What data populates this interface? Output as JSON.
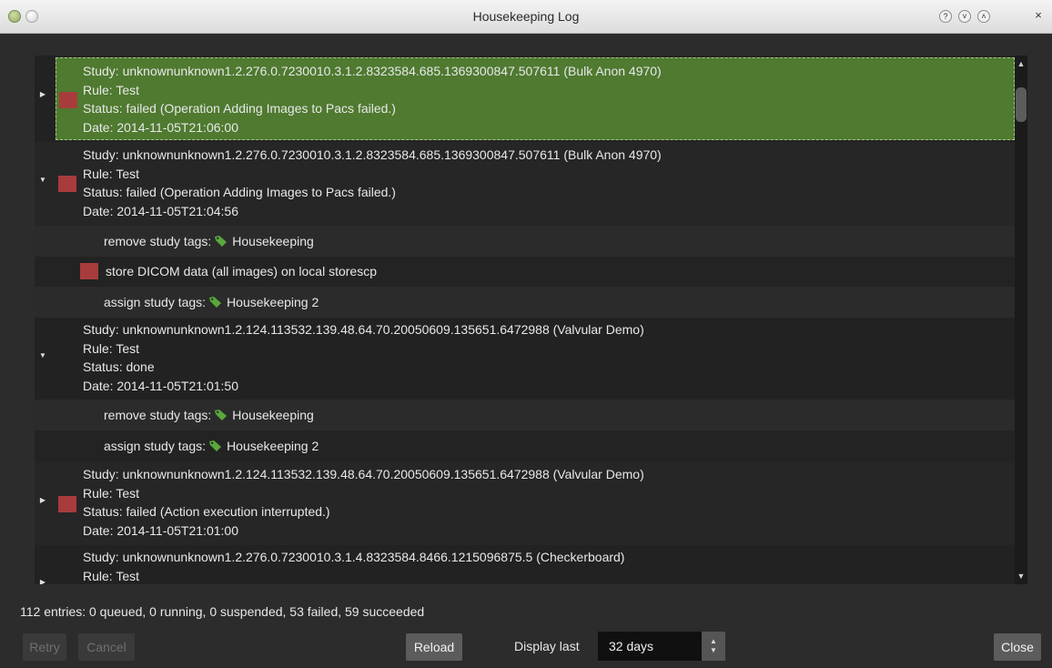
{
  "window": {
    "title": "Housekeeping Log",
    "controls": [
      "?",
      "˅",
      "˄",
      "×"
    ]
  },
  "entries": [
    {
      "study": "Study: unknownunknown1.2.276.0.7230010.3.1.2.8323584.685.1369300847.507611 (Bulk Anon 4970)",
      "rule": "Rule: Test",
      "status": "Status: failed (Operation Adding Images to Pacs failed.)",
      "date": "Date: 2014-11-05T21:06:00",
      "expanded": false,
      "failed": true,
      "selected": true
    },
    {
      "study": "Study: unknownunknown1.2.276.0.7230010.3.1.2.8323584.685.1369300847.507611 (Bulk Anon 4970)",
      "rule": "Rule: Test",
      "status": "Status: failed (Operation Adding Images to Pacs failed.)",
      "date": "Date: 2014-11-05T21:04:56",
      "expanded": true,
      "failed": true,
      "actions": [
        {
          "label": "remove study tags:",
          "tag": "Housekeeping",
          "failed": false
        },
        {
          "label": "store DICOM data (all images) on local storescp",
          "tag": "",
          "failed": true
        },
        {
          "label": "assign study tags:",
          "tag": "Housekeeping 2",
          "failed": false
        }
      ]
    },
    {
      "study": "Study: unknownunknown1.2.124.113532.139.48.64.70.20050609.135651.6472988 (Valvular Demo)",
      "rule": "Rule: Test",
      "status": "Status: done",
      "date": "Date: 2014-11-05T21:01:50",
      "expanded": true,
      "failed": false,
      "actions": [
        {
          "label": "remove study tags:",
          "tag": "Housekeeping",
          "failed": false
        },
        {
          "label": "assign study tags:",
          "tag": "Housekeeping 2",
          "failed": false
        }
      ]
    },
    {
      "study": "Study: unknownunknown1.2.124.113532.139.48.64.70.20050609.135651.6472988 (Valvular Demo)",
      "rule": "Rule: Test",
      "status": "Status: failed (Action execution interrupted.)",
      "date": "Date: 2014-11-05T21:01:00",
      "expanded": false,
      "failed": true
    },
    {
      "study": "Study: unknownunknown1.2.276.0.7230010.3.1.4.8323584.8466.1215096875.5 (Checkerboard)",
      "rule": "Rule: Test",
      "expanded": false,
      "failed": false
    }
  ],
  "summary": "112 entries: 0 queued, 0 running, 0 suspended, 53 failed, 59 succeeded",
  "buttons": {
    "retry": "Retry",
    "cancel": "Cancel",
    "reload": "Reload",
    "close": "Close"
  },
  "display": {
    "label": "Display last",
    "value": "32 days"
  },
  "colors": {
    "failed": "#a83c3c",
    "selected": "#4f7a30",
    "tag": "#5aa83c"
  }
}
